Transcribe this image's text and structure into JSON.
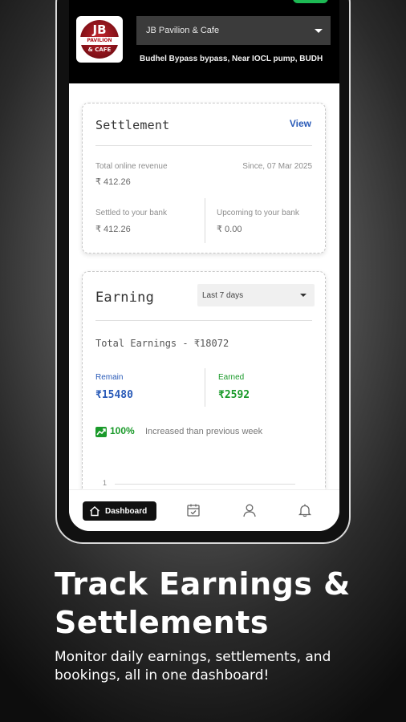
{
  "header": {
    "logo": {
      "top_text": "JB",
      "band_text": "PAVILION",
      "bottom_text": "& CAFE"
    },
    "venue_select": {
      "value": "JB Pavilion & Cafe"
    },
    "address": "Budhel Bypass bypass, Near IOCL pump, BUDH"
  },
  "settlement": {
    "title": "Settlement",
    "view_label": "View",
    "total_label": "Total online revenue",
    "total_value": "₹ 412.26",
    "since": "Since, 07 Mar 2025",
    "settled_label": "Settled to your bank",
    "settled_value": "₹ 412.26",
    "upcoming_label": "Upcoming to your bank",
    "upcoming_value": "₹ 0.00"
  },
  "earning": {
    "title": "Earning",
    "range_value": "Last 7 days",
    "total_text": "Total Earnings - ₹18072",
    "remain_label": "Remain",
    "remain_value": "₹15480",
    "earned_label": "Earned",
    "earned_value": "₹2592",
    "trend_pct": "100%",
    "trend_text": "Increased than previous week",
    "chart_tick": "1"
  },
  "bottom_nav": {
    "dashboard_label": "Dashboard"
  },
  "promo": {
    "headline_line1": "Track Earnings &",
    "headline_line2": "Settlements",
    "subtitle": "Monitor daily earnings, settlements, and bookings, all in one dashboard!"
  },
  "colors": {
    "remain": "#2a5bb8",
    "earned": "#1a9a2a",
    "view_link": "#2a5bb8",
    "header_bg": "#000000"
  }
}
